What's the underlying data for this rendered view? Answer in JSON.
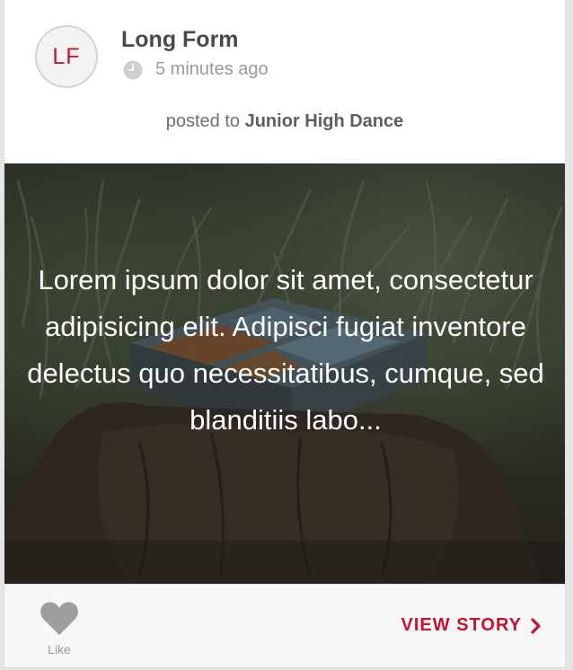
{
  "post": {
    "avatar_initials": "LF",
    "author": "Long Form",
    "timestamp": "5 minutes ago",
    "posted_prefix": "posted to",
    "group": "Junior High Dance"
  },
  "story": {
    "text": "Lorem ipsum dolor sit amet, consectetur adipisicing elit. Adipisci fugiat inventore delectus quo necessitatibus, cumque, sed blanditiis labo..."
  },
  "footer": {
    "like_label": "Like",
    "view_story_label": "VIEW STORY"
  },
  "icons": {
    "clock": "clock-icon",
    "heart": "heart-icon",
    "chevron": "chevron-right-icon"
  },
  "colors": {
    "brand_accent": "#c41230",
    "author_text": "#4a4a4a",
    "muted_text": "#9a9a9a",
    "icon_gray": "#9e9e9e"
  }
}
